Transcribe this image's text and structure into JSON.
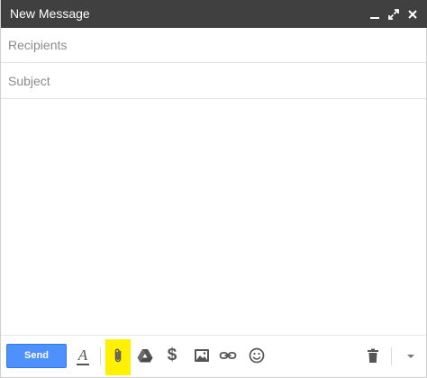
{
  "window": {
    "title": "New Message"
  },
  "fields": {
    "recipients_placeholder": "Recipients",
    "subject_placeholder": "Subject"
  },
  "toolbar": {
    "send_label": "Send",
    "format_glyph": "A",
    "money_glyph": "$",
    "highlight_color": "#fff200",
    "send_color": "#4d90fe",
    "icons": [
      "formatting-icon",
      "attach-paperclip-icon",
      "google-drive-icon",
      "money-icon",
      "insert-photo-icon",
      "insert-link-icon",
      "emoji-icon",
      "trash-icon",
      "more-options-icon"
    ]
  }
}
